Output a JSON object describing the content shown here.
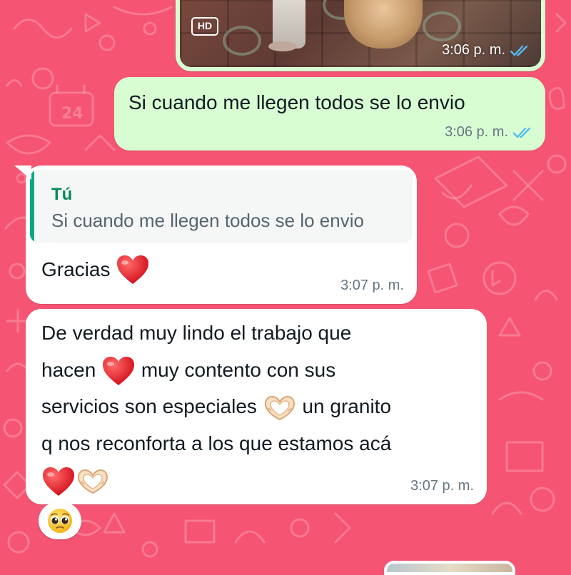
{
  "theme": {
    "wallpaper_color": "#f55572",
    "outgoing_bubble": "#d9fdd3",
    "incoming_bubble": "#ffffff",
    "read_tick_color": "#53bdeb",
    "quote_accent": "#06a884"
  },
  "messages": [
    {
      "id": "media",
      "direction": "outgoing",
      "type": "image",
      "badge": "HD",
      "time": "3:06 p. m.",
      "status_icon": "double-check-read-icon"
    },
    {
      "id": "m1",
      "direction": "outgoing",
      "text": "Si cuando me llegen todos se lo envio",
      "time": "3:06 p. m.",
      "status_icon": "double-check-read-icon"
    },
    {
      "id": "m2",
      "direction": "incoming",
      "quote": {
        "author": "Tú",
        "text": "Si cuando me llegen todos se lo envio"
      },
      "text": "Gracias",
      "emoji": [
        "red-heart-icon"
      ],
      "time": "3:07 p. m."
    },
    {
      "id": "m3",
      "direction": "incoming",
      "segments": [
        "De verdad muy lindo el trabajo que",
        "hacen",
        "muy contento con sus",
        "servicios son especiales",
        "un granito",
        "q nos reconforta a los que estamos acá"
      ],
      "emoji": [
        "red-heart-icon",
        "heart-hands-icon",
        "red-heart-icon",
        "heart-hands-icon"
      ],
      "time": "3:07 p. m."
    }
  ],
  "reaction": {
    "emoji": "pleading-face-icon",
    "on_message": "m3"
  }
}
